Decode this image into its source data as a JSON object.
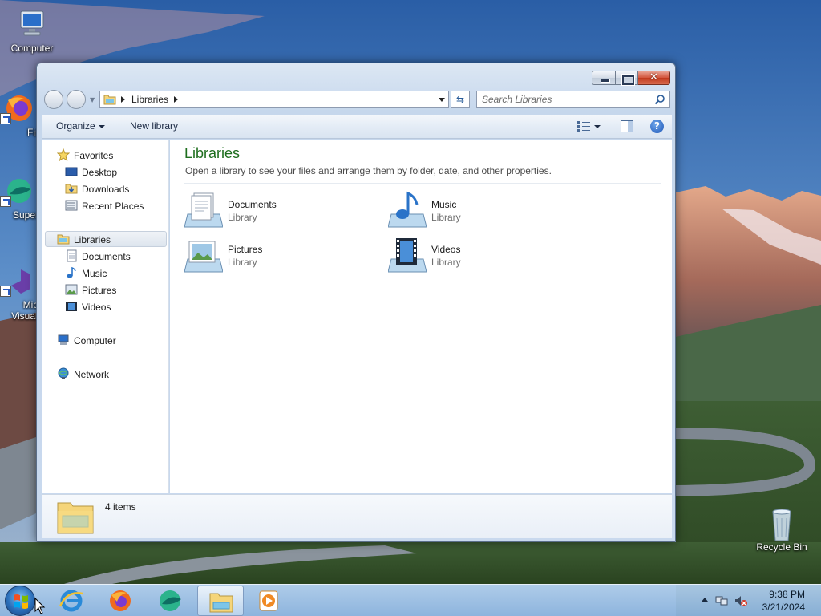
{
  "desktop": {
    "icons": [
      {
        "label": "Computer",
        "icon": "computer-icon"
      },
      {
        "label": "Firef",
        "icon": "firefox-icon"
      },
      {
        "label": "Superm",
        "icon": "app-icon"
      },
      {
        "label": "Micro\nVisual S",
        "label_line1": "Micro",
        "label_line2": "Visual S",
        "icon": "visual-studio-icon"
      },
      {
        "label": "Recycle Bin",
        "icon": "recycle-bin-icon"
      }
    ]
  },
  "window": {
    "address": {
      "crumb": "Libraries"
    },
    "search": {
      "placeholder": "Search Libraries"
    },
    "commands": {
      "organize": "Organize",
      "new_library": "New library"
    },
    "nav_pane": {
      "favorites": {
        "label": "Favorites",
        "items": [
          "Desktop",
          "Downloads",
          "Recent Places"
        ]
      },
      "libraries": {
        "label": "Libraries",
        "items": [
          "Documents",
          "Music",
          "Pictures",
          "Videos"
        ]
      },
      "computer": "Computer",
      "network": "Network"
    },
    "content": {
      "title": "Libraries",
      "description": "Open a library to see your files and arrange them by folder, date, and other properties.",
      "libraries": [
        {
          "name": "Documents",
          "type": "Library",
          "icon": "documents-library-icon"
        },
        {
          "name": "Music",
          "type": "Library",
          "icon": "music-library-icon"
        },
        {
          "name": "Pictures",
          "type": "Library",
          "icon": "pictures-library-icon"
        },
        {
          "name": "Videos",
          "type": "Library",
          "icon": "videos-library-icon"
        }
      ]
    },
    "details": {
      "item_count": "4 items"
    }
  },
  "taskbar": {
    "pinned": [
      "internet-explorer-icon",
      "firefox-icon",
      "app-icon",
      "windows-explorer-icon",
      "media-player-icon"
    ],
    "clock": {
      "time": "9:38 PM",
      "date": "3/21/2024"
    }
  },
  "colors": {
    "library_title": "#1e6e1e",
    "taskbar": "#9cc0e6",
    "close_button": "#c0391d"
  }
}
